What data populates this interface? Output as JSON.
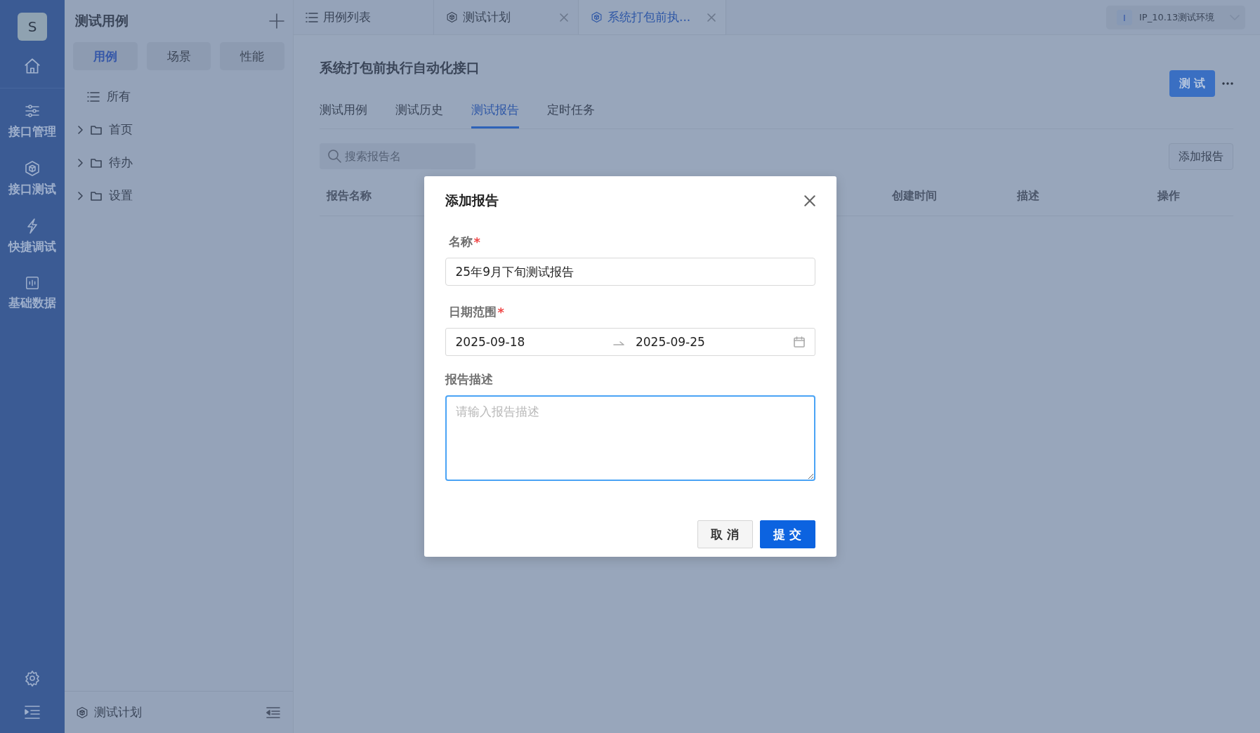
{
  "sidebar": {
    "avatar": "S",
    "items": [
      {
        "label": "接口管理"
      },
      {
        "label": "接口测试"
      },
      {
        "label": "快捷调试"
      },
      {
        "label": "基础数据"
      }
    ]
  },
  "panel": {
    "title": "测试用例",
    "segments": [
      {
        "label": "用例",
        "selected": true
      },
      {
        "label": "场景",
        "selected": false
      },
      {
        "label": "性能",
        "selected": false
      }
    ],
    "tree": [
      {
        "label": "所有",
        "kind": "all"
      },
      {
        "label": "首页",
        "kind": "folder",
        "expanded": false
      },
      {
        "label": "待办",
        "kind": "folder",
        "expanded": false
      },
      {
        "label": "设置",
        "kind": "folder",
        "expanded": false
      }
    ],
    "footer": "测试计划"
  },
  "tabs": [
    {
      "label": "用例列表",
      "closable": false,
      "selected": false
    },
    {
      "label": "测试计划",
      "closable": true,
      "selected": false
    },
    {
      "label": "系统打包前执...",
      "closable": true,
      "selected": true
    }
  ],
  "env": {
    "badge": "I",
    "label": "IP_10.13测试环境"
  },
  "page": {
    "title": "系统打包前执行自动化接口",
    "test_button": "测 试",
    "subtabs": [
      {
        "label": "测试用例",
        "selected": false
      },
      {
        "label": "测试历史",
        "selected": false
      },
      {
        "label": "测试报告",
        "selected": true
      },
      {
        "label": "定时任务",
        "selected": false
      }
    ],
    "search": {
      "placeholder": "搜索报告名"
    },
    "add_button": "添加报告",
    "columns": [
      "报告名称",
      "创建时间",
      "描述",
      "操作"
    ]
  },
  "dialog": {
    "title": "添加报告",
    "fields": [
      {
        "label": "名称",
        "required_mark": "*",
        "kind": "text",
        "value": "25年9月下旬测试报告"
      },
      {
        "label": "日期范围",
        "required_mark": "*",
        "kind": "daterange",
        "start": "2025-09-18",
        "end": "2025-09-25"
      },
      {
        "label": "报告描述",
        "kind": "textarea",
        "placeholder": "请输入报告描述",
        "focused": true
      }
    ],
    "buttons": [
      {
        "label": "取 消",
        "kind": "default"
      },
      {
        "label": "提 交",
        "kind": "primary"
      }
    ]
  }
}
